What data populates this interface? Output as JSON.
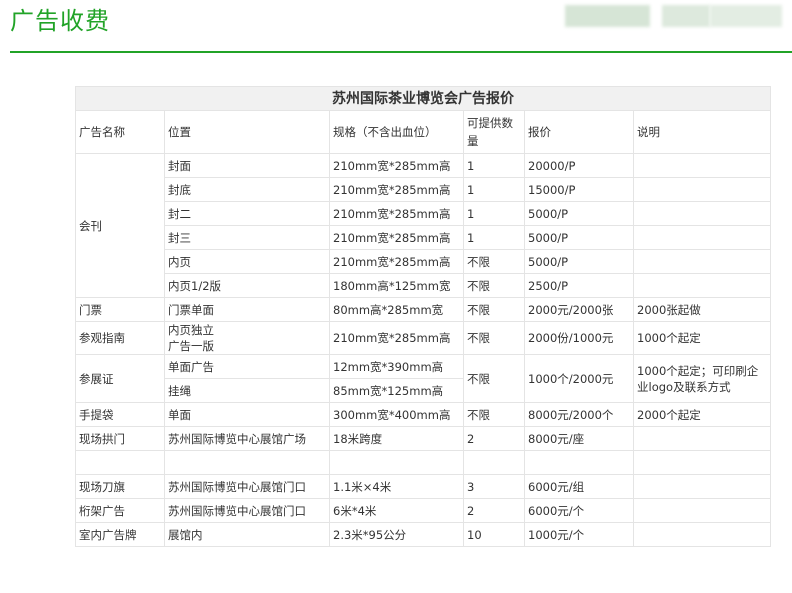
{
  "page": {
    "title": "广告收费"
  },
  "table": {
    "caption": "苏州国际茶业博览会广告报价",
    "headers": [
      "广告名称",
      "位置",
      "规格（不含出血位）",
      "可提供数量",
      "报价",
      "说明"
    ],
    "groups": {
      "huikan": "会刊",
      "menpiao": "门票",
      "canguan": "参观指南",
      "canzhan": "参展证",
      "shoutidai": "手提袋",
      "xianchang_gongmen": "现场拱门",
      "xianchang_daoqi": "现场刀旗",
      "hengjia": "桁架广告",
      "shinei": "室内广告牌"
    },
    "rows": {
      "r1": {
        "position": "封面",
        "spec": "210mm宽*285mm高",
        "qty": "1",
        "price": "20000/P",
        "note": ""
      },
      "r2": {
        "position": "封底",
        "spec": "210mm宽*285mm高",
        "qty": "1",
        "price": "15000/P",
        "note": ""
      },
      "r3": {
        "position": "封二",
        "spec": "210mm宽*285mm高",
        "qty": "1",
        "price": "5000/P",
        "note": ""
      },
      "r4": {
        "position": "封三",
        "spec": "210mm宽*285mm高",
        "qty": "1",
        "price": "5000/P",
        "note": ""
      },
      "r5": {
        "position": "内页",
        "spec": "210mm宽*285mm高",
        "qty": "不限",
        "price": "5000/P",
        "note": ""
      },
      "r6": {
        "position": "内页1/2版",
        "spec": "180mm高*125mm宽",
        "qty": "不限",
        "price": "2500/P",
        "note": ""
      },
      "r7": {
        "position": "门票单面",
        "spec": "80mm高*285mm宽",
        "qty": "不限",
        "price": "2000元/2000张",
        "note": "2000张起做"
      },
      "r8": {
        "position_line1": "内页独立",
        "position_line2": "广告一版",
        "spec": "210mm宽*285mm高",
        "qty": "不限",
        "price": "2000份/1000元",
        "note": "1000个起定"
      },
      "r9": {
        "position": "单面广告",
        "spec": "12mm宽*390mm高",
        "qty": "不限",
        "price": "1000个/2000元",
        "note_line1": "1000个起定；可印刷企",
        "note_line2": "业logo及联系方式"
      },
      "r10": {
        "position": "挂绳",
        "spec": "85mm宽*125mm高"
      },
      "r11": {
        "position": "单面",
        "spec": "300mm宽*400mm高",
        "qty": "不限",
        "price": "8000元/2000个",
        "note": "2000个起定"
      },
      "r12": {
        "position": "苏州国际博览中心展馆广场",
        "spec": "18米跨度",
        "qty": "2",
        "price": "8000元/座",
        "note": ""
      },
      "r13": {
        "position": "苏州国际博览中心展馆门口",
        "spec": "1.1米×4米",
        "qty": "3",
        "price": "6000元/组",
        "note": ""
      },
      "r14": {
        "position": "苏州国际博览中心展馆门口",
        "spec": "6米*4米",
        "qty": "2",
        "price": "6000元/个",
        "note": ""
      },
      "r15": {
        "position": "展馆内",
        "spec": "2.3米*95公分",
        "qty": "10",
        "price": "1000元/个",
        "note": ""
      }
    }
  }
}
